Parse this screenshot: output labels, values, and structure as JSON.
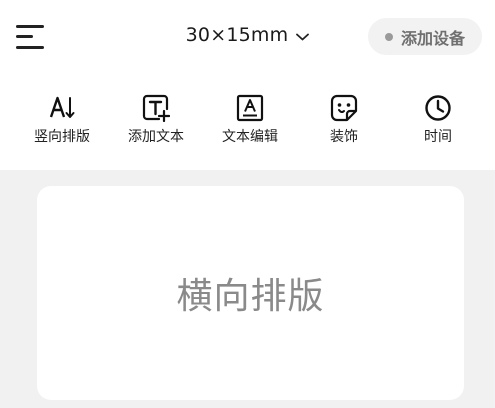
{
  "header": {
    "label_size": "30×15mm",
    "add_device_label": "添加设备",
    "status_color": "#9a9a9a"
  },
  "toolbar": {
    "items": [
      {
        "label": "竖向排版",
        "icon": "vertical-layout-icon"
      },
      {
        "label": "添加文本",
        "icon": "add-text-icon"
      },
      {
        "label": "文本编辑",
        "icon": "text-edit-icon"
      },
      {
        "label": "装饰",
        "icon": "sticker-icon"
      },
      {
        "label": "时间",
        "icon": "clock-icon"
      }
    ]
  },
  "canvas": {
    "label_text": "横向排版",
    "background": "#f1f1f1"
  }
}
